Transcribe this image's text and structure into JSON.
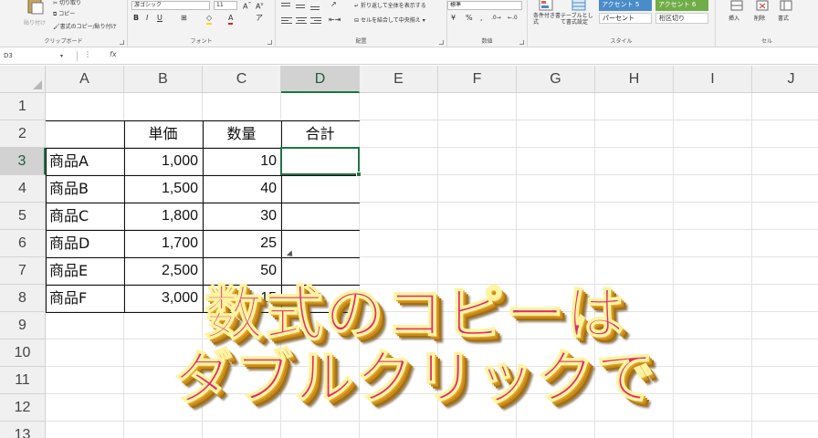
{
  "ribbon": {
    "clipboard": {
      "label": "クリップボード",
      "paste": "貼り付け",
      "cut": "切り取り",
      "copy": "コピー",
      "format_painter": "書式のコピー/貼り付け"
    },
    "font": {
      "label": "フォント",
      "font_name": "游ゴシック",
      "font_size": "11"
    },
    "alignment": {
      "label": "配置",
      "wrap_text": "折り返して全体を表示する",
      "merge_center": "セルを結合して中央揃え"
    },
    "number": {
      "label": "数値",
      "format": "標準"
    },
    "styles": {
      "label": "スタイル",
      "conditional_format": "条件付き書式",
      "format_as_table": "テーブルとして書式設定",
      "accent5": "アクセント 5",
      "accent6": "アクセント 6",
      "percent": "パーセント",
      "comma": "桁区切り"
    },
    "cells": {
      "label": "セル",
      "insert": "挿入",
      "delete": "削除",
      "format": "書式"
    }
  },
  "formula_bar": {
    "name_box": "D3",
    "fx": "fx",
    "value": ""
  },
  "sheet": {
    "columns": [
      "A",
      "B",
      "C",
      "D",
      "E",
      "F",
      "G",
      "H",
      "I",
      "J"
    ],
    "rows": [
      "1",
      "2",
      "3",
      "4",
      "5",
      "6",
      "7",
      "8",
      "9",
      "10",
      "11",
      "12",
      "13"
    ],
    "selected_cell": "D3",
    "headers": {
      "price": "単価",
      "qty": "数量",
      "total": "合計"
    },
    "items": [
      {
        "name": "商品A",
        "price": "1,000",
        "qty": "10"
      },
      {
        "name": "商品B",
        "price": "1,500",
        "qty": "40"
      },
      {
        "name": "商品C",
        "price": "1,800",
        "qty": "30"
      },
      {
        "name": "商品D",
        "price": "1,700",
        "qty": "25"
      },
      {
        "name": "商品E",
        "price": "2,500",
        "qty": "50"
      },
      {
        "name": "商品F",
        "price": "3,000",
        "qty": "15"
      }
    ]
  },
  "caption": {
    "line1": "数式のコピーは",
    "line2": "ダブルクリックで"
  },
  "colors": {
    "excel_green": "#217346",
    "caption_fill": "#e22a72",
    "caption_outline": "#fff4a0",
    "accent5": "#4a8bc9",
    "accent6": "#70ad47"
  }
}
